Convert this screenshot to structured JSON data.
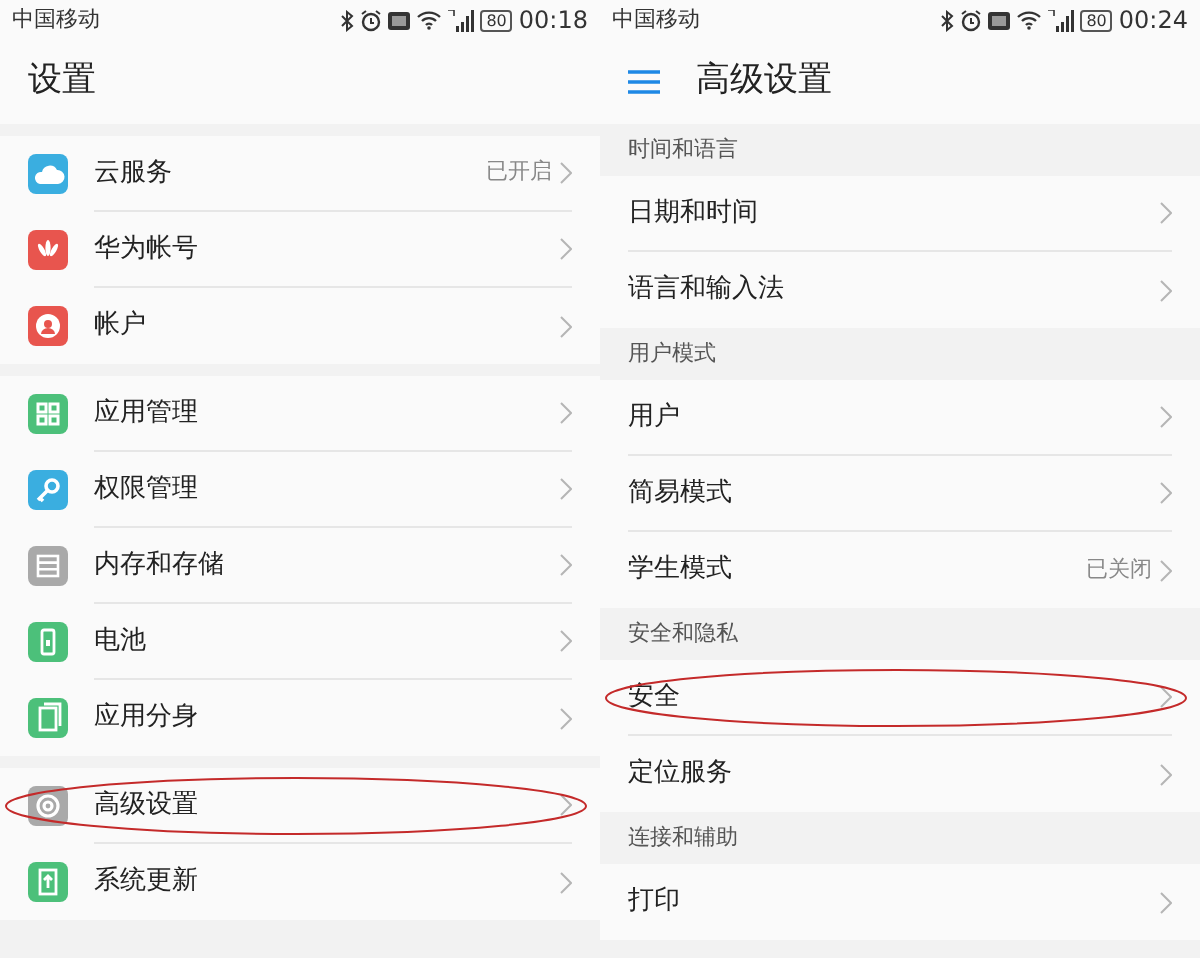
{
  "screens": [
    {
      "status_bar": {
        "carrier": "中国移动",
        "battery": "80",
        "time": "00:18"
      },
      "title": "设置",
      "has_menu": false,
      "groups": [
        {
          "items": [
            {
              "label": "云服务",
              "value": "已开启",
              "color": "#3aaee0",
              "circled": false
            },
            {
              "label": "华为帐号",
              "color": "#e8554e",
              "circled": false
            },
            {
              "label": "帐户",
              "color": "#e8554e",
              "circled": false
            }
          ]
        },
        {
          "items": [
            {
              "label": "应用管理",
              "color": "#4cc07a",
              "circled": false
            },
            {
              "label": "权限管理",
              "color": "#3aaee0",
              "circled": false
            },
            {
              "label": "内存和存储",
              "color": "#a9a9a9",
              "circled": false
            },
            {
              "label": "电池",
              "color": "#4cc07a",
              "circled": false
            },
            {
              "label": "应用分身",
              "color": "#4cc07a",
              "circled": false
            }
          ]
        },
        {
          "items": [
            {
              "label": "高级设置",
              "color": "#a9a9a9",
              "circled": true
            },
            {
              "label": "系统更新",
              "color": "#4cc07a",
              "circled": false
            }
          ]
        }
      ]
    },
    {
      "status_bar": {
        "carrier": "中国移动",
        "battery": "80",
        "time": "00:24"
      },
      "title": "高级设置",
      "has_menu": true,
      "groups": [
        {
          "header": "时间和语言",
          "items": [
            {
              "label": "日期和时间",
              "circled": false
            },
            {
              "label": "语言和输入法",
              "circled": false
            }
          ]
        },
        {
          "header": "用户模式",
          "items": [
            {
              "label": "用户",
              "circled": false
            },
            {
              "label": "简易模式",
              "circled": false
            },
            {
              "label": "学生模式",
              "value": "已关闭",
              "circled": false
            }
          ]
        },
        {
          "header": "安全和隐私",
          "items": [
            {
              "label": "安全",
              "circled": true
            },
            {
              "label": "定位服务",
              "circled": false
            }
          ]
        },
        {
          "header": "连接和辅助",
          "items": [
            {
              "label": "打印",
              "circled": false
            }
          ]
        }
      ]
    }
  ]
}
